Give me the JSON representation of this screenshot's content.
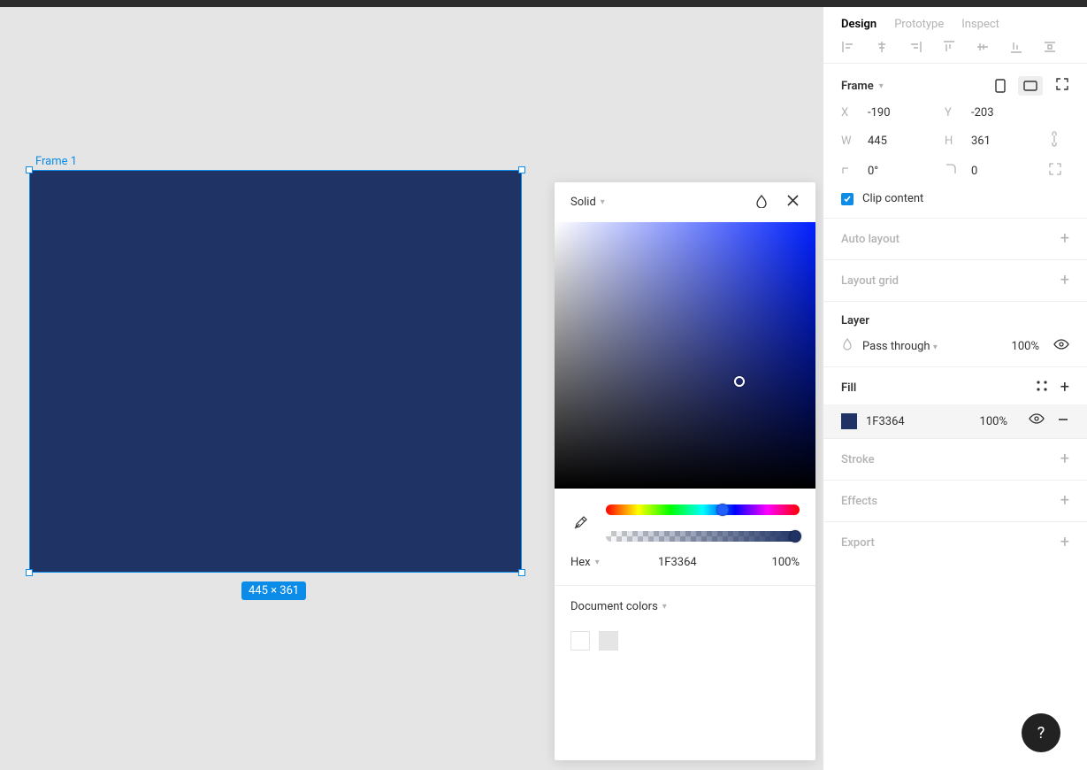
{
  "canvas": {
    "frame_label": "Frame 1",
    "dimensions_badge": "445 × 361",
    "frame_fill": "#1F3364"
  },
  "picker": {
    "type_label": "Solid",
    "hex_label": "Hex",
    "hex_value": "1F3364",
    "opacity": "100%",
    "doc_colors_label": "Document colors"
  },
  "panel": {
    "tabs": {
      "design": "Design",
      "prototype": "Prototype",
      "inspect": "Inspect"
    },
    "frame": {
      "title": "Frame",
      "x_label": "X",
      "x_value": "-190",
      "y_label": "Y",
      "y_value": "-203",
      "w_label": "W",
      "w_value": "445",
      "h_label": "H",
      "h_value": "361",
      "rotation_value": "0°",
      "radius_value": "0",
      "clip_label": "Clip content"
    },
    "auto_layout": "Auto layout",
    "layout_grid": "Layout grid",
    "layer": {
      "title": "Layer",
      "mode": "Pass through",
      "opacity": "100%"
    },
    "fill": {
      "title": "Fill",
      "hex": "1F3364",
      "opacity": "100%"
    },
    "stroke": "Stroke",
    "effects": "Effects",
    "export": "Export"
  },
  "help": "?"
}
